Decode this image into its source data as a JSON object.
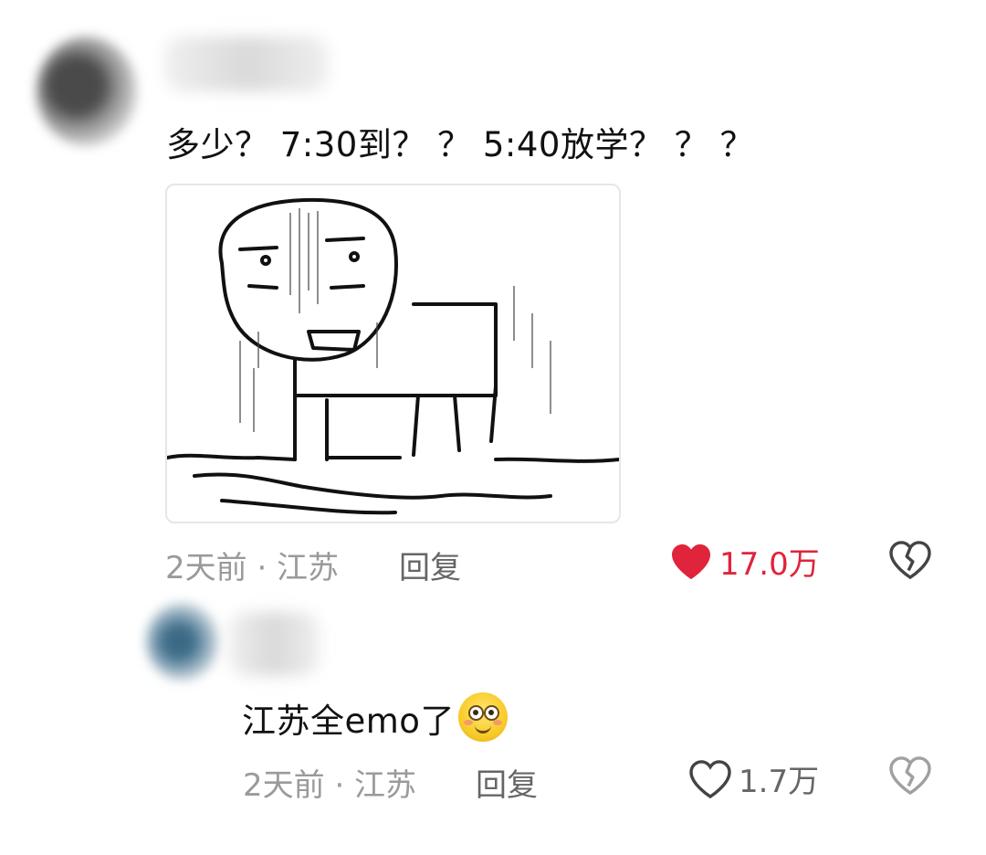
{
  "comments": [
    {
      "text": "多少？ 7:30到？ ？ 5:40放学？ ？ ？",
      "time": "2天前 · 江苏",
      "reply": "回复",
      "likes": "17.0万",
      "liked": true
    },
    {
      "text": "江苏全emo了",
      "time": "2天前 · 江苏",
      "reply": "回复",
      "likes": "1.7万",
      "liked": false
    }
  ],
  "colors": {
    "liked": "#e0243b",
    "meta": "#9a9a9a",
    "text": "#111111"
  },
  "icons": {
    "like_active": "heart-filled-icon",
    "like_inactive": "heart-outline-icon",
    "dislike": "broken-heart-icon",
    "emoji": "smiling-face-emoji-icon"
  }
}
